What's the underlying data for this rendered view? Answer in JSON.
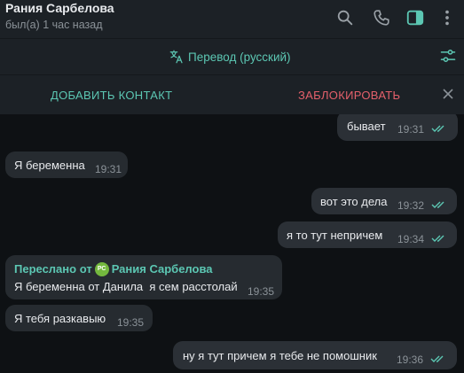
{
  "header": {
    "contact_name": "Рания Сарбелова",
    "last_seen": "был(а) 1 час назад",
    "icons": [
      "search-icon",
      "phone-icon",
      "sidebar-toggle-icon",
      "more-vert-icon"
    ]
  },
  "translate": {
    "label": "Перевод (русский)",
    "icon": "translate-icon"
  },
  "actions": {
    "add_contact": "ДОБАВИТЬ КОНТАКТ",
    "block": "ЗАБЛОКИРОВАТЬ"
  },
  "colors": {
    "accent": "#5cc7b3",
    "danger": "#e4606b",
    "avatar": "#74b83e"
  },
  "messages": [
    {
      "direction": "out",
      "text": "бывает",
      "time": "19:31",
      "read": true
    },
    {
      "direction": "in",
      "text": "Я беременна",
      "time": "19:31"
    },
    {
      "direction": "out",
      "text": "вот это дела",
      "time": "19:32",
      "read": true
    },
    {
      "direction": "out",
      "text": "я то тут непричем",
      "time": "19:34",
      "read": true
    },
    {
      "direction": "in",
      "forwarded_prefix": "Переслано от",
      "forwarded_initials": "РС",
      "forwarded_name": "Рания Сарбелова",
      "text": "Я беременна от Данила  я сем расстолай",
      "time": "19:35"
    },
    {
      "direction": "in",
      "text": "Я тебя разкавыю",
      "time": "19:35"
    },
    {
      "direction": "out",
      "text": "ну я тут причем я тебе не помошник",
      "time": "19:36",
      "read": true
    }
  ]
}
